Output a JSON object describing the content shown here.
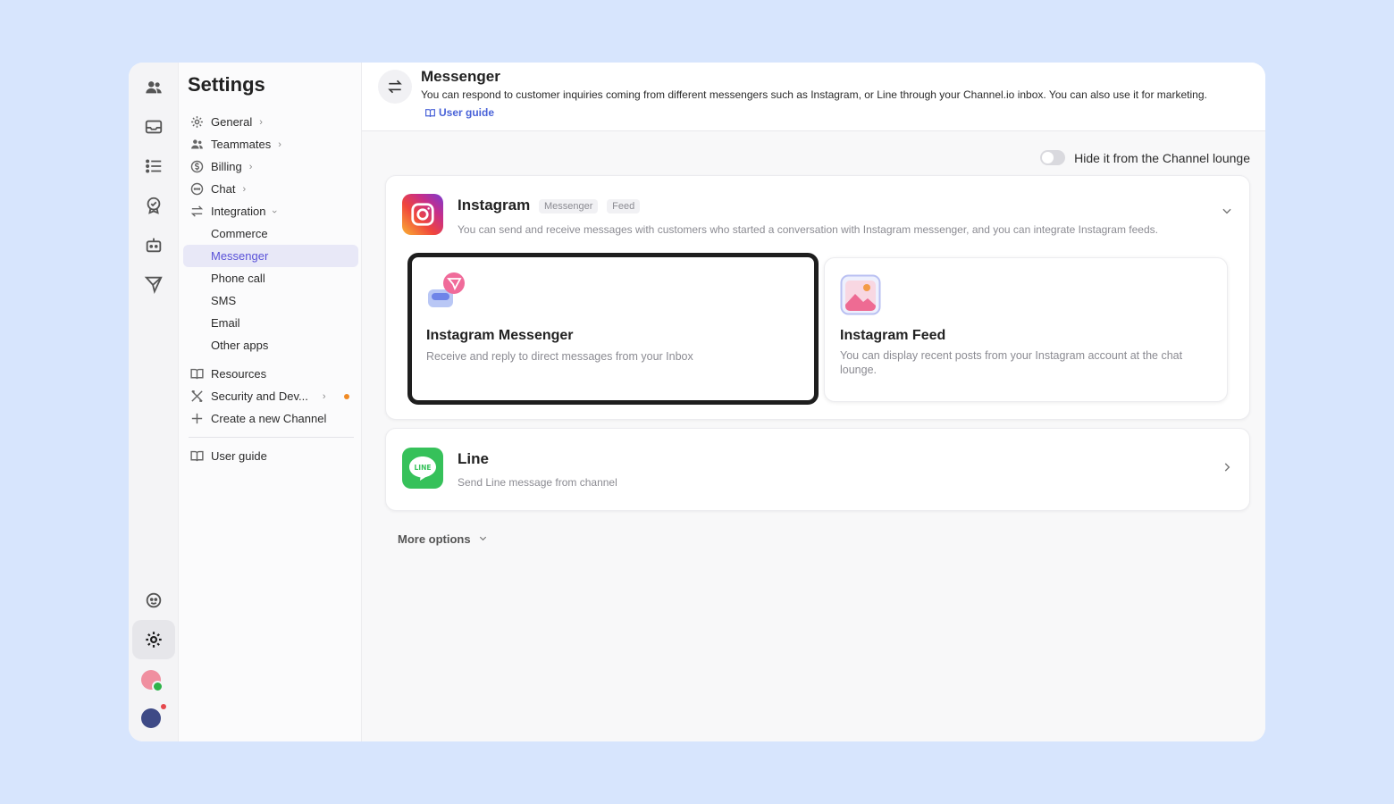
{
  "sidebar": {
    "title": "Settings",
    "items": [
      {
        "label": "General",
        "icon": "gear-icon"
      },
      {
        "label": "Teammates",
        "icon": "people-icon"
      },
      {
        "label": "Billing",
        "icon": "dollar-icon"
      },
      {
        "label": "Chat",
        "icon": "chat-icon"
      },
      {
        "label": "Integration",
        "icon": "swap-arrows-icon"
      }
    ],
    "integration_sub": [
      "Commerce",
      "Messenger",
      "Phone call",
      "SMS",
      "Email",
      "Other apps"
    ],
    "lower": [
      {
        "label": "Resources",
        "icon": "book-icon"
      },
      {
        "label": "Security and Dev...",
        "icon": "tools-icon"
      },
      {
        "label": "Create a new Channel",
        "icon": "plus-icon"
      }
    ],
    "guide": "User guide"
  },
  "header": {
    "title": "Messenger",
    "description": "You can respond to customer inquiries coming from different messengers such as Instagram, or Line through your Channel.io inbox. You can also use it for marketing.",
    "guide_link": "User guide"
  },
  "toggle": {
    "label": "Hide it from the Channel lounge",
    "on": false
  },
  "instagram": {
    "title": "Instagram",
    "tags": [
      "Messenger",
      "Feed"
    ],
    "description": "You can send and receive messages with customers who started a conversation with Instagram messenger, and you can integrate Instagram feeds.",
    "messenger": {
      "title": "Instagram Messenger",
      "description": "Receive and reply to direct messages from your Inbox"
    },
    "feed": {
      "title": "Instagram Feed",
      "description": "You can display recent posts from your Instagram account at the chat lounge."
    }
  },
  "line": {
    "title": "Line",
    "description": "Send Line message from channel",
    "logo_text": "LINE"
  },
  "more_options": "More options",
  "colors": {
    "accent": "#5a52d8",
    "link": "#4a63d8",
    "line_green": "#36c15a",
    "background": "#d7e5fd"
  }
}
